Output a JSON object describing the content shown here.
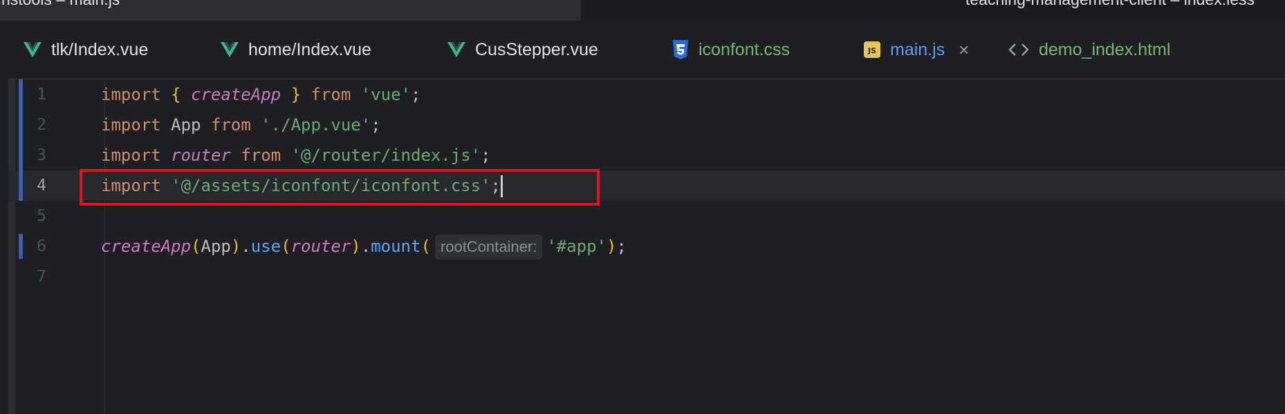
{
  "window_titles": {
    "left": "nstools – main.js",
    "right": "teaching-management-client – index.less"
  },
  "tabs": [
    {
      "label": "tlk/Index.vue",
      "kind": "vue",
      "icon": "vue-icon"
    },
    {
      "label": "home/Index.vue",
      "kind": "vue",
      "icon": "vue-icon"
    },
    {
      "label": "CusStepper.vue",
      "kind": "vue",
      "icon": "vue-icon"
    },
    {
      "label": "iconfont.css",
      "kind": "css",
      "icon": "css-icon"
    },
    {
      "label": "main.js",
      "kind": "js",
      "icon": "js-icon",
      "active": true,
      "close_glyph": "×"
    },
    {
      "label": "demo_index.html",
      "kind": "html",
      "icon": "html-icon"
    }
  ],
  "editor": {
    "current_line": 4,
    "line_numbers": [
      "1",
      "2",
      "3",
      "4",
      "5",
      "6",
      "7"
    ],
    "lines": [
      {
        "kw1": "import",
        "brace_open": "{",
        "fn": "createApp",
        "brace_close": "}",
        "kw2": "from",
        "str": "'vue'",
        "end": ";"
      },
      {
        "kw1": "import",
        "name": "App",
        "kw2": "from",
        "str": "'./App.vue'",
        "end": ";"
      },
      {
        "kw1": "import",
        "ident": "router",
        "kw2": "from",
        "str": "'@/router/index.js'",
        "end": ";"
      },
      {
        "kw1": "import",
        "str": "'@/assets/iconfont/iconfont.css'",
        "end": ";"
      },
      {},
      {
        "fn": "createApp",
        "po1": "(",
        "arg1": "App",
        "pc1": ")",
        "dot1": ".",
        "m1": "use",
        "po2": "(",
        "arg2": "router",
        "pc2": ")",
        "dot2": ".",
        "m2": "mount",
        "po3": "(",
        "hint": "rootContainer:",
        "str": "'#app'",
        "pc3": ")",
        "end": ";"
      },
      {}
    ]
  },
  "colors": {
    "highlight_box": "#e0141c",
    "active_tab_underline": "#3574f0",
    "vue_green": "#41b883",
    "css_blue": "#2f6bd8",
    "js_yellow": "#e9c262"
  }
}
